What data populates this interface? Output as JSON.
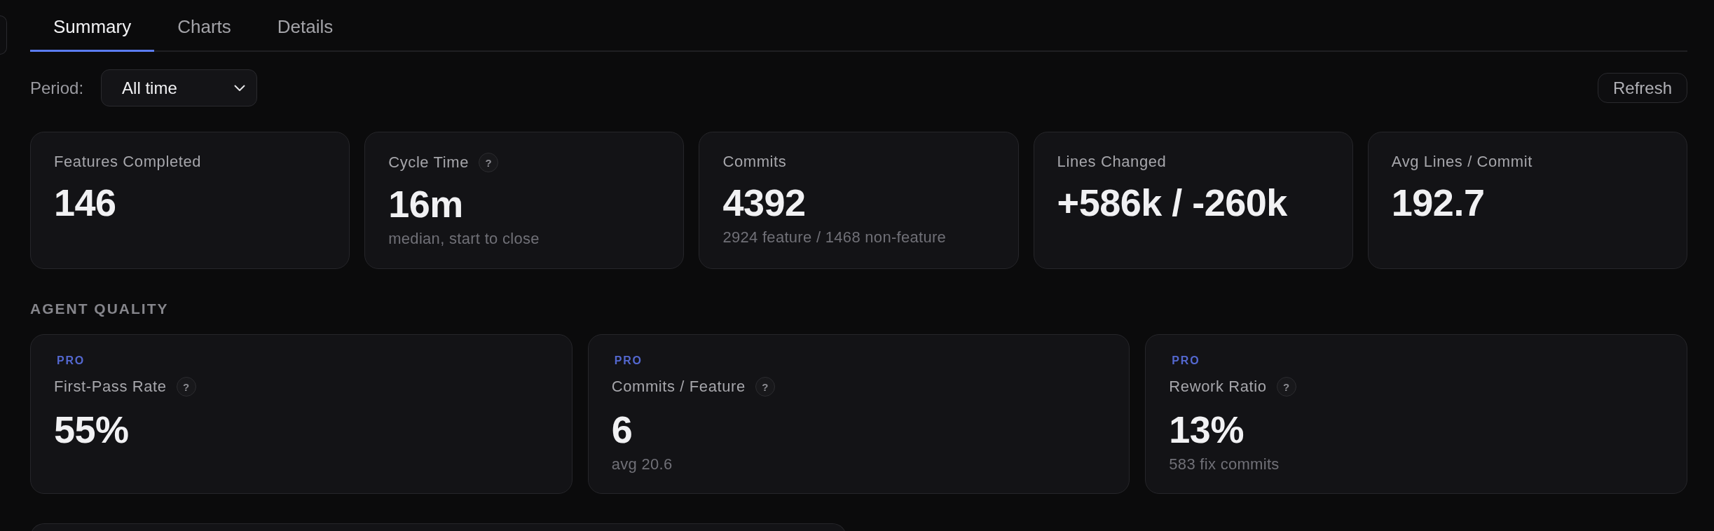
{
  "tabs": [
    {
      "label": "Summary",
      "selected": true
    },
    {
      "label": "Charts",
      "selected": false
    },
    {
      "label": "Details",
      "selected": false
    }
  ],
  "period": {
    "label": "Period:",
    "value": "All time"
  },
  "refresh_button": "Refresh",
  "stats": [
    {
      "label": "Features Completed",
      "value": "146"
    },
    {
      "label": "Cycle Time",
      "help": "?",
      "value": "16m",
      "note": "median, start to close"
    },
    {
      "label": "Commits",
      "value": "4392",
      "note": "2924 feature / 1468 non-feature"
    },
    {
      "label": "Lines Changed",
      "value": "+586k / -260k"
    },
    {
      "label": "Avg Lines / Commit",
      "value": "192.7"
    }
  ],
  "agent_quality": {
    "title": "AGENT QUALITY",
    "cards": [
      {
        "badge": "PRO",
        "label": "First-Pass Rate",
        "help": "?",
        "value": "55%"
      },
      {
        "badge": "PRO",
        "label": "Commits / Feature",
        "help": "?",
        "value": "6",
        "note": "avg 20.6"
      },
      {
        "badge": "PRO",
        "label": "Rework Ratio",
        "help": "?",
        "value": "13%",
        "note": "583 fix commits"
      }
    ]
  }
}
